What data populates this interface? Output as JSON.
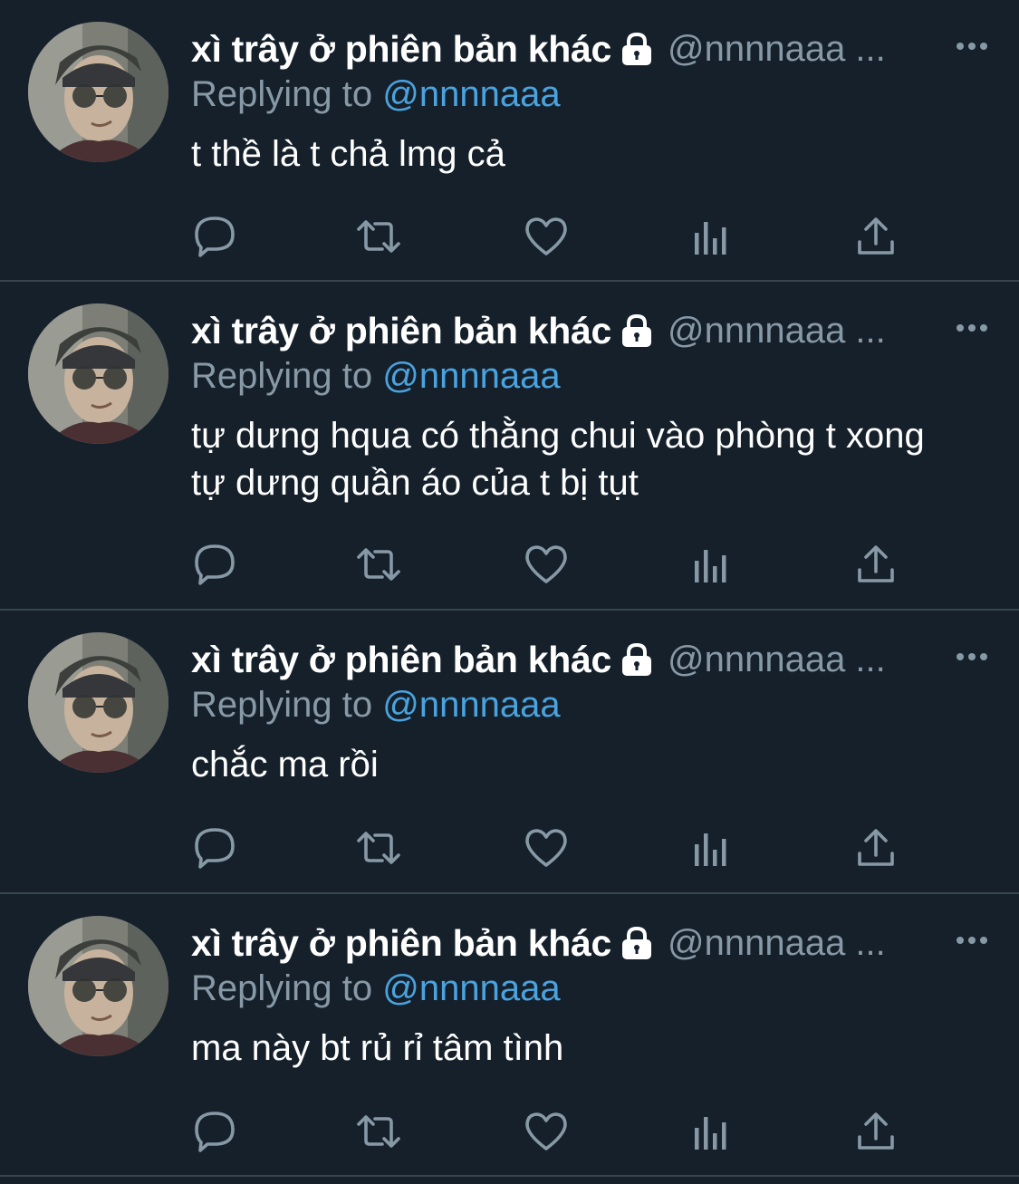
{
  "colors": {
    "background": "#15202b",
    "divider": "#38444d",
    "muted": "#8899a6",
    "link": "#4aa3df",
    "text": "#ffffff"
  },
  "tweets": [
    {
      "display_name": "xì trây ở phiên bản khác",
      "handle": "@nnnnaaa ...",
      "replying_label": "Replying to",
      "replying_handle": "@nnnnaaa",
      "text": "t thề là t chả lmg cả",
      "icons": [
        "avatar",
        "lock-icon",
        "more-icon",
        "reply-icon",
        "retweet-icon",
        "like-icon",
        "analytics-icon",
        "share-icon"
      ]
    },
    {
      "display_name": "xì trây ở phiên bản khác",
      "handle": "@nnnnaaa ...",
      "replying_label": "Replying to",
      "replying_handle": "@nnnnaaa",
      "text": "tự dưng hqua có thằng chui vào phòng t xong tự dưng quần áo của t bị tụt",
      "icons": [
        "avatar",
        "lock-icon",
        "more-icon",
        "reply-icon",
        "retweet-icon",
        "like-icon",
        "analytics-icon",
        "share-icon"
      ]
    },
    {
      "display_name": "xì trây ở phiên bản khác",
      "handle": "@nnnnaaa ...",
      "replying_label": "Replying to",
      "replying_handle": "@nnnnaaa",
      "text": "chắc ma rồi",
      "icons": [
        "avatar",
        "lock-icon",
        "more-icon",
        "reply-icon",
        "retweet-icon",
        "like-icon",
        "analytics-icon",
        "share-icon"
      ]
    },
    {
      "display_name": "xì trây ở phiên bản khác",
      "handle": "@nnnnaaa ...",
      "replying_label": "Replying to",
      "replying_handle": "@nnnnaaa",
      "text": "ma này bt rủ rỉ tâm tình",
      "icons": [
        "avatar",
        "lock-icon",
        "more-icon",
        "reply-icon",
        "retweet-icon",
        "like-icon",
        "analytics-icon",
        "share-icon"
      ]
    }
  ]
}
